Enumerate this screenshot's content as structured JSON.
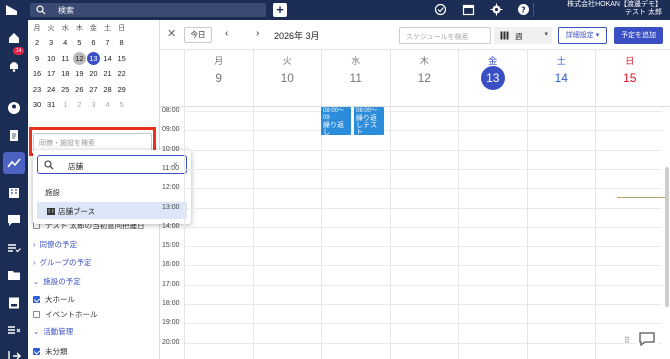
{
  "topbar": {
    "search_placeholder": "検索",
    "plus_label": "+",
    "company": "株式会社HOKAN【渡邊デモ】",
    "user": "テスト 太郎",
    "icons": [
      "home-logo-icon",
      "search-icon",
      "check-circle-icon",
      "calendar-icon",
      "gear-icon",
      "help-icon"
    ]
  },
  "rail": {
    "badge": "14",
    "icons": [
      "home-icon",
      "bell-icon",
      "person-icon",
      "document-icon",
      "chart-icon",
      "building-icon",
      "chat-icon",
      "task-icon",
      "folder-icon",
      "report-icon",
      "list-icon",
      "logout-icon"
    ]
  },
  "mini_calendar": {
    "weekdays": [
      "月",
      "火",
      "水",
      "木",
      "金",
      "土",
      "日"
    ],
    "weeks": [
      [
        "2",
        "3",
        "4",
        "5",
        "6",
        "7",
        "8"
      ],
      [
        "9",
        "10",
        "11",
        "12",
        "13",
        "14",
        "15"
      ],
      [
        "16",
        "17",
        "18",
        "19",
        "20",
        "21",
        "22"
      ],
      [
        "23",
        "24",
        "25",
        "26",
        "27",
        "28",
        "29"
      ],
      [
        "30",
        "31",
        "1",
        "2",
        "3",
        "4",
        "5"
      ]
    ],
    "today": "12",
    "selected": "13"
  },
  "sidebar": {
    "search_placeholder": "同僚・施設を検索",
    "items": [
      {
        "type": "checkbox",
        "checked": false,
        "label": "テスト 太郎の当初意向把握日"
      },
      {
        "type": "link",
        "label": "同僚の予定"
      },
      {
        "type": "link",
        "label": "グループの予定"
      },
      {
        "type": "section",
        "label": "施設の予定"
      },
      {
        "type": "checkbox",
        "checked": true,
        "label": "大ホール"
      },
      {
        "type": "checkbox",
        "checked": false,
        "label": "イベントホール"
      },
      {
        "type": "section",
        "label": "活動管理"
      },
      {
        "type": "checkbox",
        "checked": true,
        "label": "未分類"
      }
    ]
  },
  "popup": {
    "query": "店舗",
    "clear": "×",
    "section": "施設",
    "option": "店舗ブース"
  },
  "toolbar": {
    "close": "✕",
    "today": "今日",
    "prev": "‹",
    "next": "›",
    "month": "2026年 3月",
    "search_placeholder": "スケジュールを検索",
    "view": "週",
    "view_caret": "▾",
    "detail": "詳細設定 ▾",
    "add": "予定を追加"
  },
  "week": [
    {
      "name": "月",
      "num": "9"
    },
    {
      "name": "火",
      "num": "10"
    },
    {
      "name": "水",
      "num": "11"
    },
    {
      "name": "木",
      "num": "12"
    },
    {
      "name": "金",
      "num": "13"
    },
    {
      "name": "土",
      "num": "14"
    },
    {
      "name": "日",
      "num": "15"
    }
  ],
  "times": [
    "08:00",
    "09:00",
    "10:00",
    "11:00",
    "12:00",
    "13:00",
    "14:00",
    "15:00",
    "16:00",
    "17:00",
    "18:00",
    "19:00",
    "20:00"
  ],
  "events": [
    {
      "time": "08:00～09",
      "title": "繰り返し"
    },
    {
      "time": "08:00～",
      "title": "繰り返しテスト"
    }
  ],
  "colors": {
    "navy": "#1c2d55",
    "accent": "#3b4fc4",
    "event": "#2b8cdc",
    "highlight": "#e8321e"
  }
}
